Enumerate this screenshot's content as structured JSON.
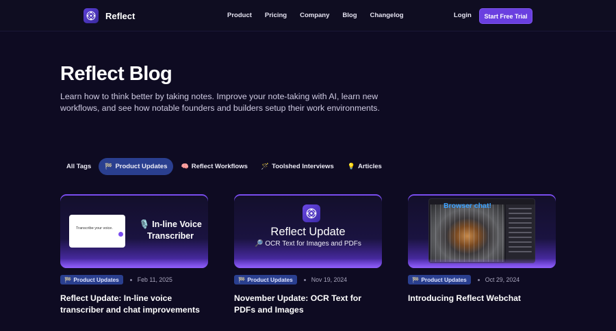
{
  "nav": {
    "brand": "Reflect",
    "links": [
      "Product",
      "Pricing",
      "Company",
      "Blog",
      "Changelog"
    ],
    "login": "Login",
    "cta": "Start Free Trial"
  },
  "hero": {
    "title": "Reflect Blog",
    "description": "Learn how to think better by taking notes. Improve your note-taking with AI, learn new workflows, and see how notable founders and builders setup their work environments."
  },
  "tags": [
    {
      "icon": "",
      "label": "All Tags",
      "active": false
    },
    {
      "icon": "🏁",
      "label": "Product Updates",
      "active": true
    },
    {
      "icon": "🧠",
      "label": "Reflect Workflows",
      "active": false
    },
    {
      "icon": "🪄",
      "label": "Toolshed Interviews",
      "active": false
    },
    {
      "icon": "💡",
      "label": "Articles",
      "active": false
    }
  ],
  "posts": [
    {
      "tag": "Product Updates",
      "tag_icon": "🏁",
      "date": "Feb 11, 2025",
      "title": "Reflect Update: In-line voice transcriber and chat improvements",
      "thumb_card_text": "Transcribe your voice.",
      "thumb_title": "🎙️ In-line Voice Transcriber"
    },
    {
      "tag": "Product Updates",
      "tag_icon": "🏁",
      "date": "Nov 19, 2024",
      "title": "November Update: OCR Text for PDFs and Images",
      "thumb_title": "Reflect Update",
      "thumb_subtitle": "🔎 OCR Text for Images and PDFs"
    },
    {
      "tag": "Product Updates",
      "tag_icon": "🏁",
      "date": "Oct 29, 2024",
      "title": "Introducing Reflect Webchat",
      "thumb_label": "Browser chat!"
    }
  ],
  "colors": {
    "background": "#0e0b22",
    "accent": "#6a3fe0",
    "tag_active": "#2a3f8f"
  }
}
